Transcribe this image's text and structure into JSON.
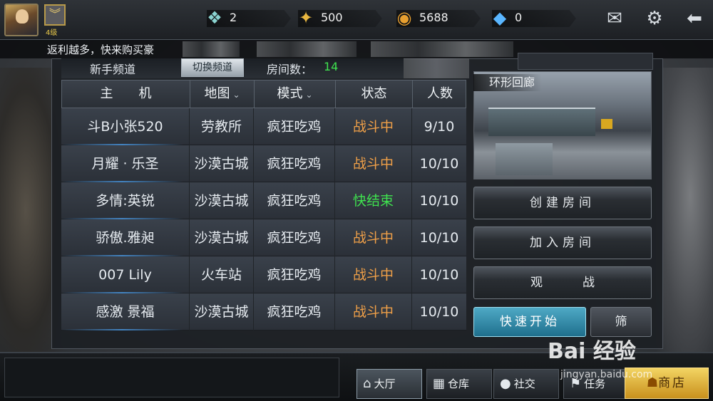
{
  "topbar": {
    "rank_label": "4级",
    "resources": [
      {
        "icon": "cash-card-icon",
        "value": "2"
      },
      {
        "icon": "gold-token-icon",
        "value": "500"
      },
      {
        "icon": "coin-icon",
        "value": "5688"
      },
      {
        "icon": "diamond-icon",
        "value": "0"
      }
    ]
  },
  "marquee": {
    "text": "返利越多，快来购买豪"
  },
  "channel": {
    "name": "新手频道",
    "switch_label": "切换频道",
    "room_count_label": "房间数：",
    "room_count": "14"
  },
  "table": {
    "headers": {
      "host": "主　　机",
      "map": "地图",
      "mode": "模式",
      "status": "状态",
      "players": "人数"
    },
    "rows": [
      {
        "host": "斗B小张520",
        "map": "劳教所",
        "mode": "疯狂吃鸡",
        "status": "战斗中",
        "players": "9/10",
        "status_type": "fight"
      },
      {
        "host": "月耀 · 乐圣",
        "map": "沙漠古城",
        "mode": "疯狂吃鸡",
        "status": "战斗中",
        "players": "10/10",
        "status_type": "fight"
      },
      {
        "host": "多情:英锐",
        "map": "沙漠古城",
        "mode": "疯狂吃鸡",
        "status": "快结束",
        "players": "10/10",
        "status_type": "end"
      },
      {
        "host": "骄傲.雅昶",
        "map": "沙漠古城",
        "mode": "疯狂吃鸡",
        "status": "战斗中",
        "players": "10/10",
        "status_type": "fight"
      },
      {
        "host": "007 Lily",
        "map": "火车站",
        "mode": "疯狂吃鸡",
        "status": "战斗中",
        "players": "10/10",
        "status_type": "fight"
      },
      {
        "host": "感激 景福",
        "map": "沙漠古城",
        "mode": "疯狂吃鸡",
        "status": "战斗中",
        "players": "10/10",
        "status_type": "fight"
      }
    ]
  },
  "preview": {
    "map_name": "环形回廊"
  },
  "actions": {
    "create": "创建房间",
    "join": "加入房间",
    "watch": "观战",
    "quick_start": "快速开始",
    "filter": "筛"
  },
  "nav": {
    "hall": "大厅",
    "storage": "仓库",
    "social": "社交",
    "task": "任务",
    "shop": "商店"
  },
  "watermark": {
    "logo": "Bai 经验",
    "url": "jingyan.baidu.com"
  },
  "colors": {
    "status_fight": "#f0a048",
    "status_end": "#3fe24f",
    "room_count": "#3fe24f",
    "quick_start_bg": "#2f8fb0",
    "shop_bg": "#e4b540"
  }
}
